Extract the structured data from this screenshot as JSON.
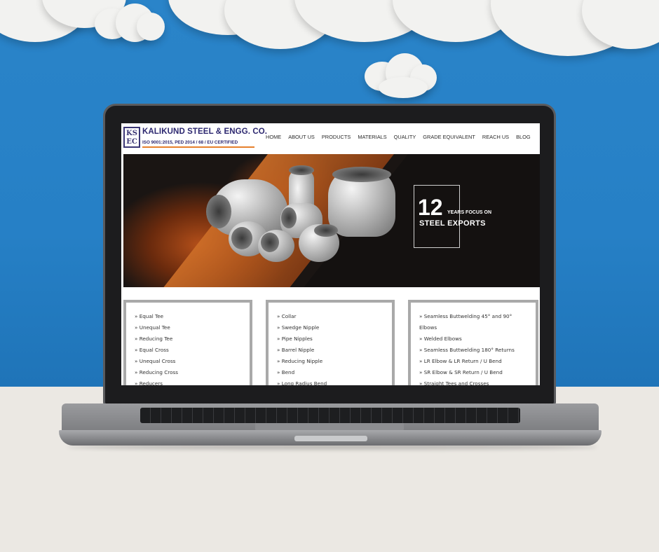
{
  "site": {
    "logo_mark": "KS EC",
    "brand_name": "KALIKUND STEEL & ENGG. CO.",
    "brand_tagline": "ISO 9001:2015, PED 2014 / 68 / EU CERTIFIED"
  },
  "nav": {
    "items": [
      "HOME",
      "ABOUT US",
      "PRODUCTS",
      "MATERIALS",
      "QUALITY",
      "GRADE EQUIVALENT",
      "REACH US",
      "BLOG"
    ]
  },
  "banner": {
    "stat_number": "12",
    "stat_caption": "YEARS FOCUS ON",
    "stat_headline": "STEEL EXPORTS"
  },
  "product_columns": [
    {
      "items": [
        "Equal Tee",
        "Unequal Tee",
        "Reducing Tee",
        "Equal Cross",
        "Unequal Cross",
        "Reducing Cross",
        "Reducers"
      ]
    },
    {
      "items": [
        "Collar",
        "Swedge Nipple",
        "Pipe Nipples",
        "Barrel Nipple",
        "Reducing Nipple",
        "Bend",
        "Long Radius Bend"
      ]
    },
    {
      "items": [
        "Seamless Buttwelding 45° and 90° Elbows",
        "Welded Elbows",
        "Seamless Buttwelding 180° Returns",
        "LR Elbow & LR Return / U Bend",
        "SR Elbow & SR Return / U Bend",
        "Straight Tees and Crosses"
      ]
    }
  ],
  "colors": {
    "sky": "#2680c6",
    "brand": "#2d2870",
    "accent": "#e6802c",
    "card_border": "#a9a9a9"
  }
}
